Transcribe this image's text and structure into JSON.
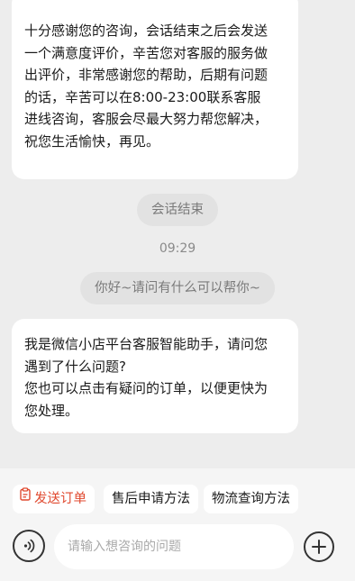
{
  "messages": {
    "closing_lines": [
      "十分感谢您的咨询，会话结束之后会发送",
      "一个满意度评价，辛苦您对客服的服务做",
      "出评价，非常感谢您的帮助，后期有问题",
      "的话，辛苦可以在8:00-23:00联系客服",
      "进线咨询，客服会尽最大努力帮您解决，",
      "祝您生活愉快，再见。"
    ],
    "session_ended": "会话结束",
    "time": "09:29",
    "greeting": "你好~请问有什么可以帮你~",
    "assistant_lines": [
      "我是微信小店平台客服智能助手，请问您",
      "遇到了什么问题?",
      "您也可以点击有疑问的订单，以便更快为",
      "您处理。"
    ]
  },
  "quick_actions": {
    "send_order": "发送订单",
    "aftersale": "售后申请方法",
    "logistics": "物流查询方法"
  },
  "composer": {
    "placeholder": "请输入想咨询的问题"
  },
  "colors": {
    "accent": "#e0492f",
    "chat_background": "#ededed"
  }
}
